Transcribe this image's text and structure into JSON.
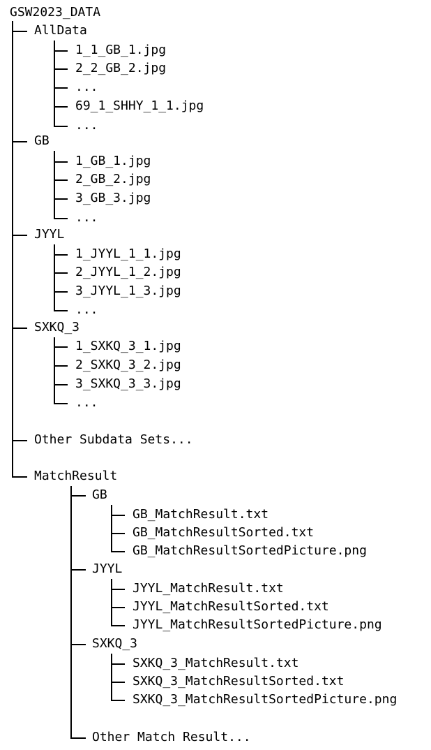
{
  "root": "GSW2023_DATA",
  "alldata": {
    "label": "AllData",
    "files": [
      "1_1_GB_1.jpg",
      "2_2_GB_2.jpg",
      "...",
      "69_1_SHHY_1_1.jpg",
      "..."
    ]
  },
  "gb": {
    "label": "GB",
    "files": [
      "1_GB_1.jpg",
      "2_GB_2.jpg",
      "3_GB_3.jpg",
      "..."
    ]
  },
  "jyyl": {
    "label": "JYYL",
    "files": [
      "1_JYYL_1_1.jpg",
      "2_JYYL_1_2.jpg",
      "3_JYYL_1_3.jpg",
      "..."
    ]
  },
  "sxkq": {
    "label": "SXKQ_3",
    "files": [
      "1_SXKQ_3_1.jpg",
      "2_SXKQ_3_2.jpg",
      "3_SXKQ_3_3.jpg",
      "..."
    ]
  },
  "other_subdata": "Other Subdata Sets...",
  "match": {
    "label": "MatchResult",
    "gb": {
      "label": "GB",
      "files": [
        "GB_MatchResult.txt",
        "GB_MatchResultSorted.txt",
        "GB_MatchResultSortedPicture.png"
      ]
    },
    "jyyl": {
      "label": "JYYL",
      "files": [
        "JYYL_MatchResult.txt",
        "JYYL_MatchResultSorted.txt",
        "JYYL_MatchResultSortedPicture.png"
      ]
    },
    "sxkq": {
      "label": "SXKQ_3",
      "files": [
        "SXKQ_3_MatchResult.txt",
        "SXKQ_3_MatchResultSorted.txt",
        "SXKQ_3_MatchResultSortedPicture.png"
      ]
    },
    "other": "Other Match Result..."
  }
}
